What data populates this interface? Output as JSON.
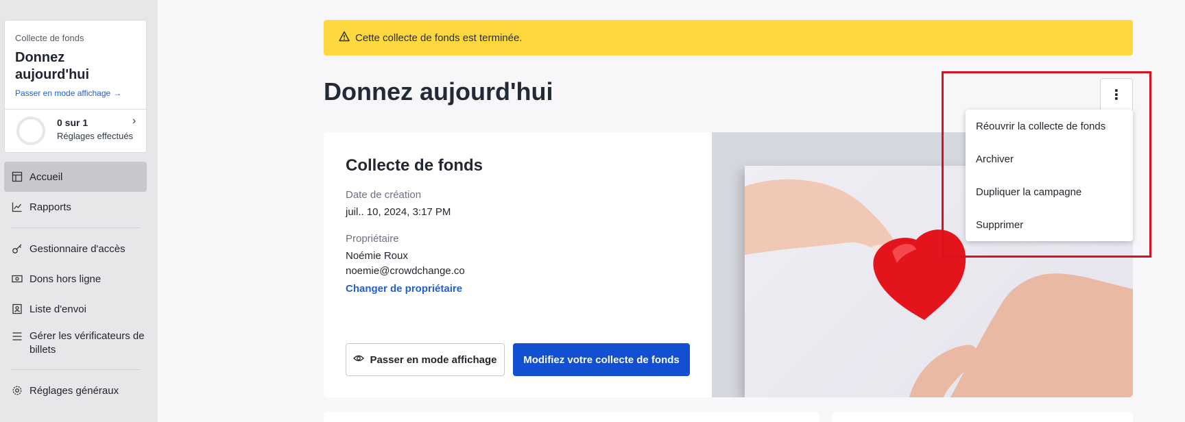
{
  "sidebar": {
    "card": {
      "section_label": "Collecte de fonds",
      "title": "Donnez aujourd'hui",
      "view_link": "Passer en mode affichage",
      "progress_count": "0 sur 1",
      "progress_sub": "Réglages effectués"
    },
    "items": [
      {
        "label": "Accueil",
        "icon": "layout-icon"
      },
      {
        "label": "Rapports",
        "icon": "chart-icon"
      },
      {
        "label": "Gestionnaire d'accès",
        "icon": "key-icon"
      },
      {
        "label": "Dons hors ligne",
        "icon": "cash-icon"
      },
      {
        "label": "Liste d'envoi",
        "icon": "contact-icon"
      },
      {
        "label": "Gérer les vérificateurs de billets",
        "icon": "list-icon"
      },
      {
        "label": "Réglages généraux",
        "icon": "gear-icon"
      }
    ]
  },
  "alert": {
    "text": "Cette collecte de fonds est terminée."
  },
  "page": {
    "title": "Donnez aujourd'hui"
  },
  "card": {
    "title": "Collecte de fonds",
    "created_label": "Date de création",
    "created_value": "juil.. 10, 2024, 3:17 PM",
    "owner_label": "Propriétaire",
    "owner_name": "Noémie Roux",
    "owner_email": "noemie@crowdchange.co",
    "change_owner": "Changer de propriétaire",
    "view_button": "Passer en mode affichage",
    "edit_button": "Modifiez votre collecte de fonds"
  },
  "menu": {
    "items": [
      "Réouvrir la collecte de fonds",
      "Archiver",
      "Dupliquer la campagne",
      "Supprimer"
    ]
  },
  "colors": {
    "alert_bg": "#fdd83e",
    "primary": "#1350d1",
    "link": "#1f5fd6",
    "highlight": "#d9111e"
  }
}
